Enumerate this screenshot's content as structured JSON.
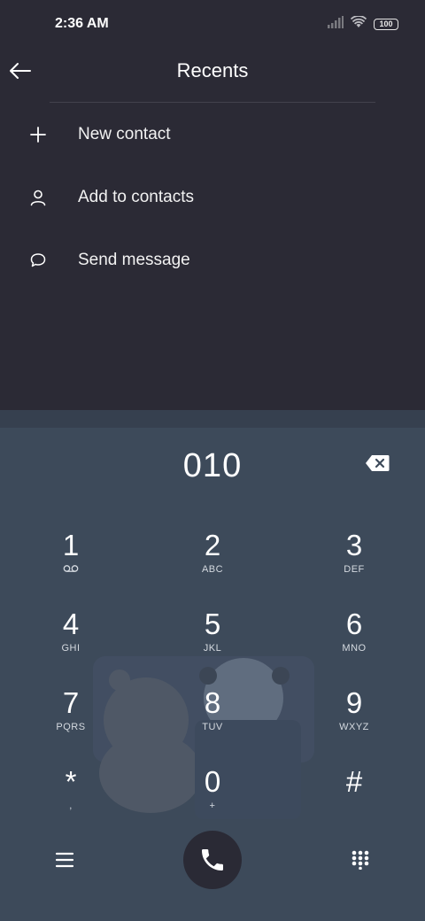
{
  "status_bar": {
    "time": "2:36 AM",
    "battery": "100",
    "icons": [
      "signal-icon",
      "wifi-icon",
      "battery-icon"
    ]
  },
  "header": {
    "title": "Recents",
    "back_icon": "back-arrow-icon"
  },
  "actions": [
    {
      "label": "New contact",
      "icon": "plus-icon"
    },
    {
      "label": "Add to contacts",
      "icon": "person-icon"
    },
    {
      "label": "Send message",
      "icon": "message-icon"
    }
  ],
  "dialer": {
    "number": "010",
    "keys": [
      {
        "digit": "1",
        "letters": ""
      },
      {
        "digit": "2",
        "letters": "ABC"
      },
      {
        "digit": "3",
        "letters": "DEF"
      },
      {
        "digit": "4",
        "letters": "GHI"
      },
      {
        "digit": "5",
        "letters": "JKL"
      },
      {
        "digit": "6",
        "letters": "MNO"
      },
      {
        "digit": "7",
        "letters": "PQRS"
      },
      {
        "digit": "8",
        "letters": "TUV"
      },
      {
        "digit": "9",
        "letters": "WXYZ"
      },
      {
        "digit": "*",
        "letters": ","
      },
      {
        "digit": "0",
        "letters": "+"
      },
      {
        "digit": "#",
        "letters": ""
      }
    ]
  },
  "colors": {
    "top_background": "#2b2a35",
    "dialer_background": "#3d4a5a",
    "call_button": "#2a2a35",
    "text": "#ffffff"
  }
}
